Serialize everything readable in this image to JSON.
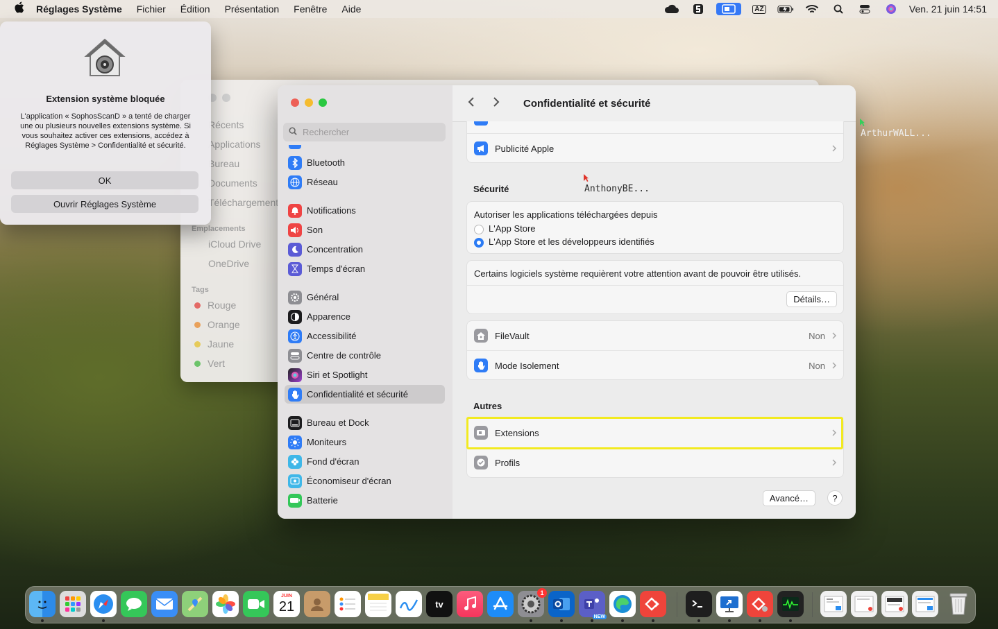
{
  "menubar": {
    "app_name": "Réglages Système",
    "menus": [
      "Fichier",
      "Édition",
      "Présentation",
      "Fenêtre",
      "Aide"
    ],
    "status_icons": [
      "cloud-icon",
      "s-icon",
      "screen-icon",
      "az-icon",
      "battery-icon",
      "wifi-icon",
      "search-icon",
      "control-center-icon",
      "siri-icon"
    ],
    "az_label": "AZ",
    "clock": "Ven. 21 juin  14:51"
  },
  "finder": {
    "favorites": [
      "Récents",
      "Applications",
      "Bureau",
      "Documents",
      "Téléchargements"
    ],
    "locations_header": "Emplacements",
    "locations": [
      "iCloud Drive",
      "OneDrive"
    ],
    "tags_header": "Tags",
    "tags": [
      {
        "label": "Rouge",
        "color": "#e46a66"
      },
      {
        "label": "Orange",
        "color": "#e9a15a"
      },
      {
        "label": "Jaune",
        "color": "#e6cb5a"
      },
      {
        "label": "Vert",
        "color": "#6cc46a"
      }
    ]
  },
  "alert": {
    "title": "Extension système bloquée",
    "message": "L'application « SophosScanD » a tenté de charger une ou plusieurs nouvelles extensions système. Si vous souhaitez activer ces extensions, accédez à Réglages Système > Confidentialité et sécurité.",
    "ok_label": "OK",
    "open_label": "Ouvrir Réglages Système"
  },
  "settings": {
    "search_placeholder": "Rechercher",
    "sidebar": [
      {
        "label": "Bluetooth",
        "icon": "bluetooth-icon",
        "color": "#2f7cf6"
      },
      {
        "label": "Réseau",
        "icon": "globe-icon",
        "color": "#2f7cf6"
      },
      {
        "label": "Notifications",
        "icon": "bell-icon",
        "color": "#ef4444"
      },
      {
        "label": "Son",
        "icon": "speaker-icon",
        "color": "#ef4444"
      },
      {
        "label": "Concentration",
        "icon": "moon-icon",
        "color": "#5b5bd6"
      },
      {
        "label": "Temps d'écran",
        "icon": "hourglass-icon",
        "color": "#5b5bd6"
      },
      {
        "label": "Général",
        "icon": "gear-icon",
        "color": "#8e8e93"
      },
      {
        "label": "Apparence",
        "icon": "appearance-icon",
        "color": "#1c1c1e"
      },
      {
        "label": "Accessibilité",
        "icon": "accessibility-icon",
        "color": "#2f7cf6"
      },
      {
        "label": "Centre de contrôle",
        "icon": "toggles-icon",
        "color": "#8e8e93"
      },
      {
        "label": "Siri et Spotlight",
        "icon": "siri-icon",
        "color": "#a040d0"
      },
      {
        "label": "Confidentialité et sécurité",
        "icon": "hand-icon",
        "color": "#2f7cf6"
      },
      {
        "label": "Bureau et Dock",
        "icon": "dock-icon",
        "color": "#1c1c1e"
      },
      {
        "label": "Moniteurs",
        "icon": "sun-icon",
        "color": "#2f7cf6"
      },
      {
        "label": "Fond d'écran",
        "icon": "flower-icon",
        "color": "#3fb7e8"
      },
      {
        "label": "Économiseur d'écran",
        "icon": "screensaver-icon",
        "color": "#3fb7e8"
      },
      {
        "label": "Batterie",
        "icon": "battery-icon",
        "color": "#34c759"
      }
    ],
    "title": "Confidentialité et sécurité",
    "apple_ads": "Publicité Apple",
    "security_header": "Sécurité",
    "allow_label": "Autoriser les applications téléchargées depuis",
    "option_app_store": "L'App Store",
    "option_app_store_devs": "L'App Store et les développeurs identifiés",
    "attention_text": "Certains logiciels système requièrent votre attention avant de pouvoir être utilisés.",
    "details_button": "Détails…",
    "filevault": "FileVault",
    "filevault_value": "Non",
    "lockdown": "Mode Isolement",
    "lockdown_value": "Non",
    "others_header": "Autres",
    "extensions": "Extensions",
    "profiles": "Profils",
    "advanced_button": "Avancé…",
    "help": "?"
  },
  "overlay": {
    "anthony_label": "AnthonyBE...",
    "arthur_label": "ArthurWALL..."
  },
  "dock": {
    "calendar_month": "JUIN",
    "calendar_day": "21",
    "tv_label": "tv",
    "new_badge": "NEW",
    "settings_badge": "1",
    "apps": [
      "finder-icon",
      "launchpad-icon",
      "safari-icon",
      "messages-icon",
      "mail-icon",
      "maps-icon",
      "photos-icon",
      "facetime-icon",
      "calendar-icon",
      "contacts-icon",
      "reminders-icon",
      "notes-icon",
      "freeform-icon",
      "tv-icon",
      "music-icon",
      "app-store-icon",
      "system-settings-icon",
      "outlook-icon",
      "teams-icon",
      "edge-icon",
      "anydesk-icon",
      "terminal-icon",
      "remote-desktop-icon",
      "anydesk-alt-icon",
      "activity-monitor-icon",
      "doc-thumb-1-icon",
      "doc-thumb-2-icon",
      "doc-thumb-3-icon",
      "doc-thumb-4-icon",
      "trash-icon"
    ]
  }
}
